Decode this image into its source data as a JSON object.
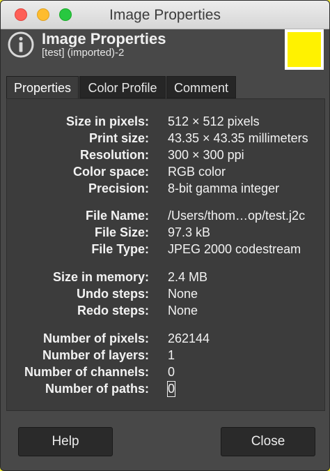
{
  "window": {
    "title": "Image Properties"
  },
  "header": {
    "title": "Image Properties",
    "subtitle": "[test] (imported)-2",
    "thumbnail_color": "#fff200"
  },
  "tabs": [
    {
      "label": "Properties",
      "active": true
    },
    {
      "label": "Color Profile",
      "active": false
    },
    {
      "label": "Comment",
      "active": false
    }
  ],
  "properties": {
    "group1": [
      {
        "label": "Size in pixels:",
        "value": "512 × 512 pixels"
      },
      {
        "label": "Print size:",
        "value": "43.35 × 43.35 millimeters"
      },
      {
        "label": "Resolution:",
        "value": "300 × 300 ppi"
      },
      {
        "label": "Color space:",
        "value": "RGB color"
      },
      {
        "label": "Precision:",
        "value": "8-bit gamma integer"
      }
    ],
    "group2": [
      {
        "label": "File Name:",
        "value": "/Users/thom…op/test.j2c"
      },
      {
        "label": "File Size:",
        "value": "97.3 kB"
      },
      {
        "label": "File Type:",
        "value": "JPEG 2000 codestream"
      }
    ],
    "group3": [
      {
        "label": "Size in memory:",
        "value": "2.4 MB"
      },
      {
        "label": "Undo steps:",
        "value": "None"
      },
      {
        "label": "Redo steps:",
        "value": "None"
      }
    ],
    "group4": [
      {
        "label": "Number of pixels:",
        "value": "262144"
      },
      {
        "label": "Number of layers:",
        "value": "1"
      },
      {
        "label": "Number of channels:",
        "value": "0"
      },
      {
        "label": "Number of paths:",
        "value": "0"
      }
    ]
  },
  "buttons": {
    "help": "Help",
    "close": "Close"
  }
}
